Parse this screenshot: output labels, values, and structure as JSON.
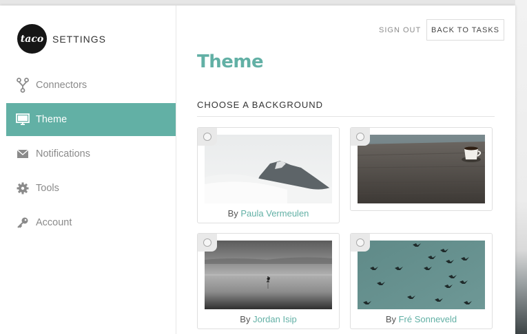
{
  "app": {
    "logo_text": "taco",
    "title": "SETTINGS"
  },
  "sidebar": {
    "items": [
      {
        "label": "Connectors",
        "icon": "connectors-icon",
        "active": false
      },
      {
        "label": "Theme",
        "icon": "monitor-icon",
        "active": true
      },
      {
        "label": "Notifications",
        "icon": "envelope-icon",
        "active": false
      },
      {
        "label": "Tools",
        "icon": "gear-icon",
        "active": false
      },
      {
        "label": "Account",
        "icon": "key-icon",
        "active": false
      }
    ]
  },
  "header": {
    "sign_out": "SIGN OUT",
    "back_to_tasks": "BACK TO TASKS"
  },
  "main": {
    "title": "Theme",
    "section_title": "CHOOSE A BACKGROUND",
    "backgrounds": [
      {
        "by": "By",
        "author": "Paula Vermeulen",
        "image": "misty-mountain",
        "selected": false
      },
      {
        "by": "",
        "author": "",
        "image": "coffee-on-table",
        "selected": false
      },
      {
        "by": "By",
        "author": "Jordan Isip",
        "image": "heron-on-lake",
        "selected": false
      },
      {
        "by": "By",
        "author": "Fré Sonneveld",
        "image": "birds-in-sky",
        "selected": false
      }
    ]
  },
  "colors": {
    "accent": "#62b0a5",
    "text": "#333333",
    "muted": "#8a8a8a"
  }
}
